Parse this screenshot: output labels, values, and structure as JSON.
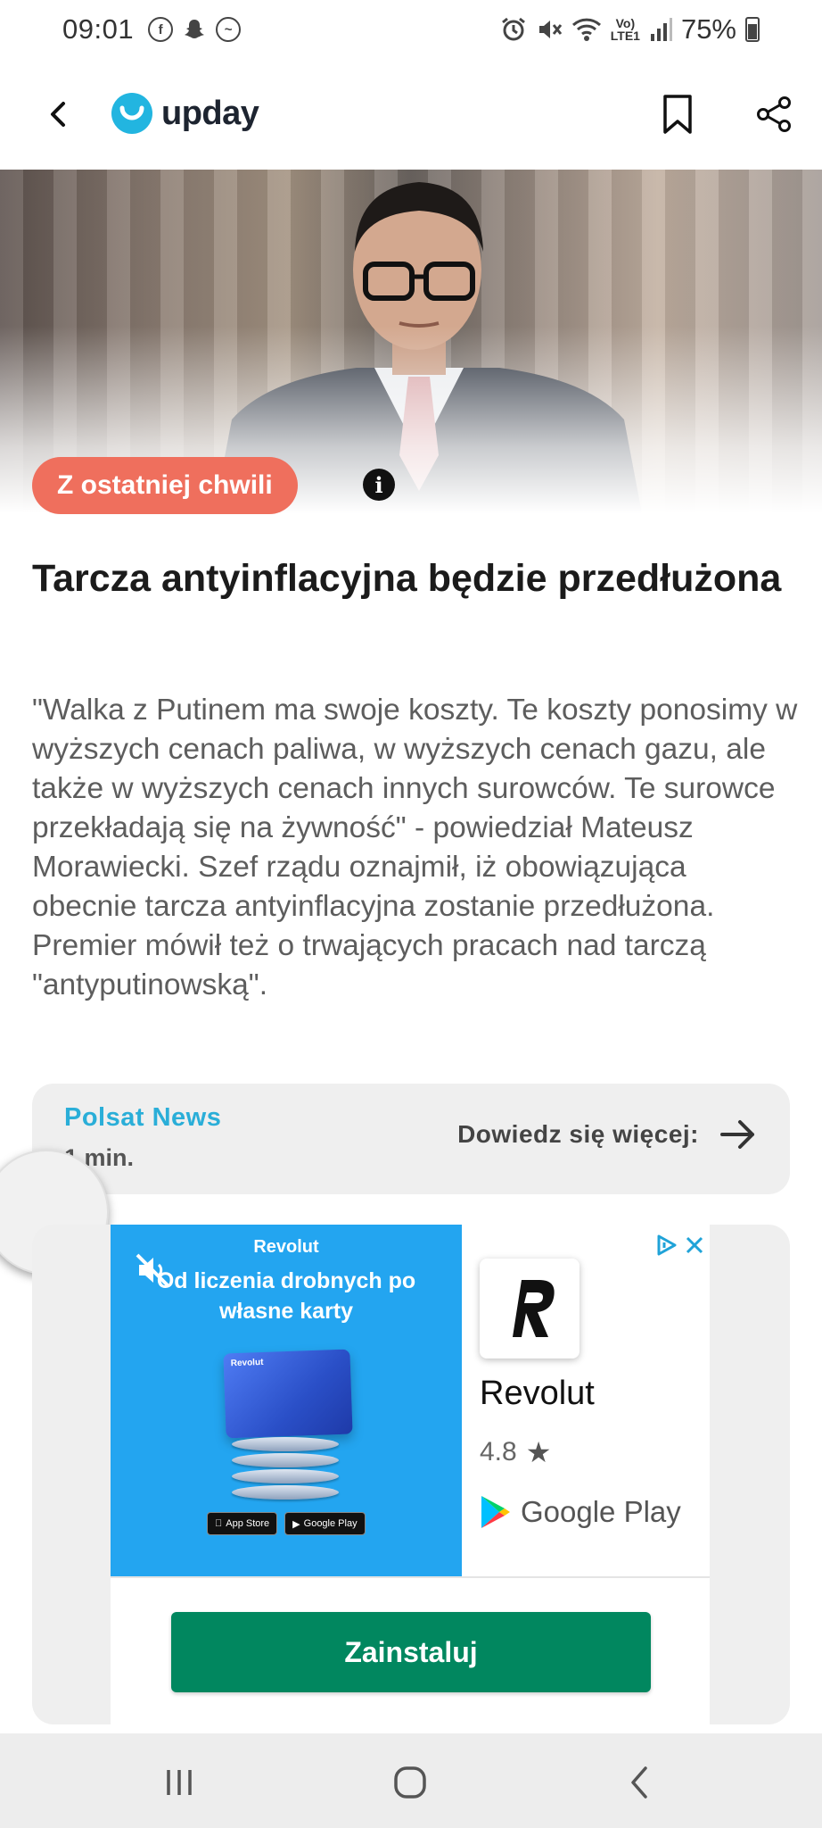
{
  "status_bar": {
    "time": "09:01",
    "volte_label": "Vo)",
    "lte_label": "LTE1",
    "battery": "75%"
  },
  "app_bar": {
    "logo_text": "upday",
    "logo_color": "#22b5e0"
  },
  "hero": {
    "badge_label": "Z ostatniej chwili",
    "badge_color": "#ef6f5d"
  },
  "article": {
    "headline": "Tarcza antyinflacyjna będzie przedłużona",
    "body": "\"Walka z Putinem ma swoje koszty. Te koszty ponosimy w wyższych cenach paliwa, w wyższych cenach gazu, ale także w wyższych cenach innych surowców. Te surowce przekładają się na żywność\" - powiedział Mateusz Morawiecki. Szef rządu oznajmił, iż obowiązująca obecnie tarcza antyinflacyjna zostanie przedłużona. Premier mówił też o trwających pracach nad tarczą \"antyputinowską\"."
  },
  "source": {
    "name": "Polsat News",
    "read_time": "1 min.",
    "more_label": "Dowiedz się więcej:",
    "name_color": "#2aaed8"
  },
  "ad": {
    "banner_brand": "Revolut",
    "banner_tagline": "Od liczenia drobnych po własne karty",
    "card_label": "Revolut",
    "store_badge_1": "App Store",
    "store_badge_2": "Google Play",
    "app_name": "Revolut",
    "rating": "4.8",
    "store_name": "Google Play",
    "install_label": "Zainstaluj",
    "install_color": "#01875f",
    "banner_color": "#23a5f0"
  }
}
